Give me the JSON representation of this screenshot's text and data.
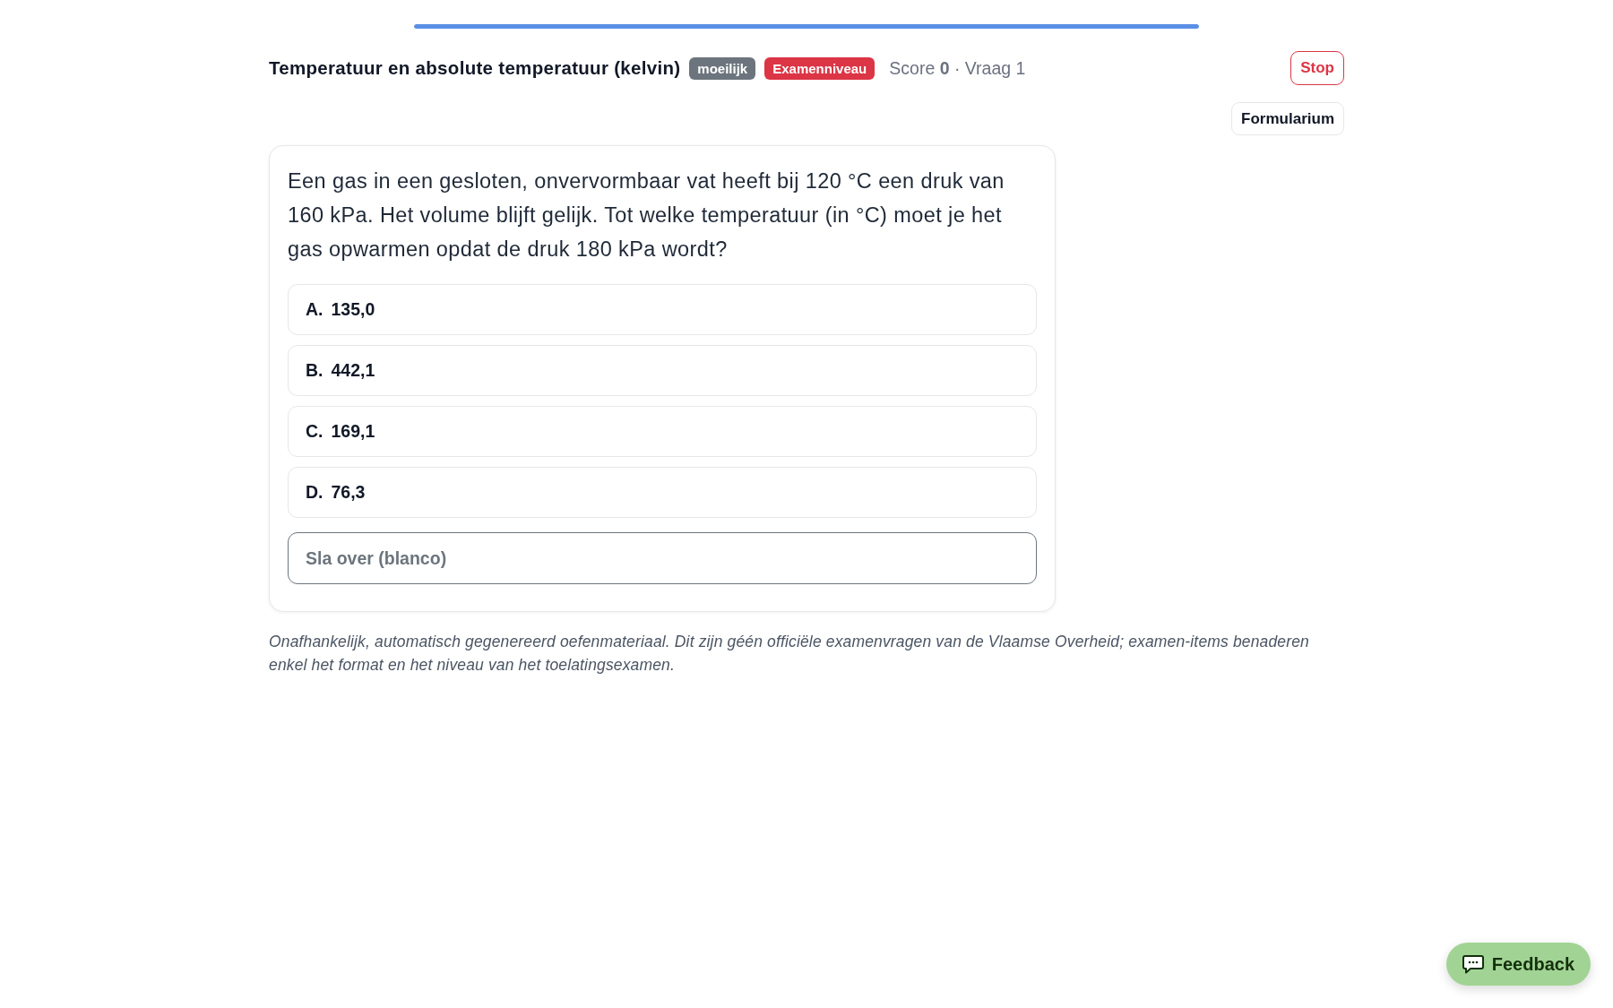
{
  "progress": {
    "level": 1
  },
  "header": {
    "title": "Temperatuur en absolute temperatuur (kelvin)",
    "badges": [
      {
        "label": "moeilijk",
        "color": "#6c757d"
      },
      {
        "label": "Examenniveau",
        "color": "#dc3545"
      }
    ],
    "score": "Score **0** · Vraag 1",
    "stop_button": {
      "label": "Stop"
    }
  },
  "formularium_button": {
    "label": "Formularium"
  },
  "question": {
    "text": "Een gas in een gesloten, onvervormbaar vat heeft bij 120 °C een druk van 160 kPa. Het volume blijft gelijk. Tot welke temperatuur (in °C) moet je het gas opwarmen opdat de druk 180 kPa wordt?",
    "options": [
      {
        "letter": "A.",
        "value": "135,0",
        "selected": false
      },
      {
        "letter": "B.",
        "value": "442,1",
        "selected": false
      },
      {
        "letter": "C.",
        "value": "169,1",
        "selected": false
      },
      {
        "letter": "D.",
        "value": "76,3",
        "selected": false
      }
    ],
    "skip_button": {
      "label": "Sla over (blanco)"
    }
  },
  "disclaimer": "Onafhankelijk, automatisch gegenereerd oefenmateriaal. Dit zijn géén officiële examenvragen van de Vlaamse Overheid; examen-items benaderen enkel het format en het niveau van het toelatingsexamen.",
  "feedback_button": {
    "label": "Feedback"
  }
}
